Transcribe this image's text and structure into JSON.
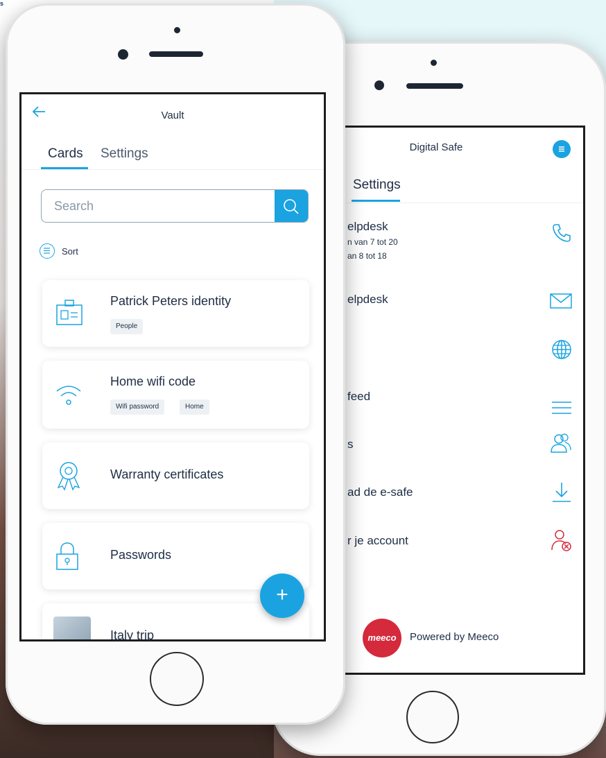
{
  "corner_text": "s",
  "left_phone": {
    "title": "Vault",
    "tabs": [
      {
        "label": "Cards",
        "active": true
      },
      {
        "label": "Settings",
        "active": false
      }
    ],
    "search_placeholder": "Search",
    "sort_label": "Sort",
    "cards": [
      {
        "title": "Patrick Peters identity",
        "icon": "id-badge-icon",
        "tags": [
          "People"
        ]
      },
      {
        "title": "Home wifi code",
        "icon": "wifi-icon",
        "tags": [
          "Wifi password",
          "Home"
        ]
      },
      {
        "title": "Warranty certificates",
        "icon": "ribbon-award-icon",
        "tags": []
      },
      {
        "title": "Passwords",
        "icon": "lock-icon",
        "tags": []
      },
      {
        "title": "Italy trip",
        "icon": "photo-thumbnail",
        "tags": []
      }
    ],
    "fab_label": "+"
  },
  "right_phone": {
    "title": "Digital Safe",
    "tab": "Settings",
    "rows": [
      {
        "title": "elpdesk",
        "sub": [
          "n van 7 tot 20",
          "an 8 tot 18"
        ],
        "icon": "phone-icon"
      },
      {
        "title": "elpdesk",
        "sub": [],
        "icon": "mail-icon"
      },
      {
        "title": "",
        "sub": [],
        "icon": "globe-icon"
      },
      {
        "title": "feed",
        "sub": [],
        "icon": "list-icon"
      },
      {
        "title": "s",
        "sub": [],
        "icon": "users-icon"
      },
      {
        "title": "ad de e-safe",
        "sub": [],
        "icon": "download-icon"
      },
      {
        "title": "r je account",
        "sub": [],
        "icon": "user-remove-icon"
      }
    ],
    "logo_text": "meeco",
    "powered_by": "Powered by Meeco"
  },
  "colors": {
    "accent": "#1aa3e0",
    "text": "#1e2d44",
    "danger": "#d42a3c"
  }
}
